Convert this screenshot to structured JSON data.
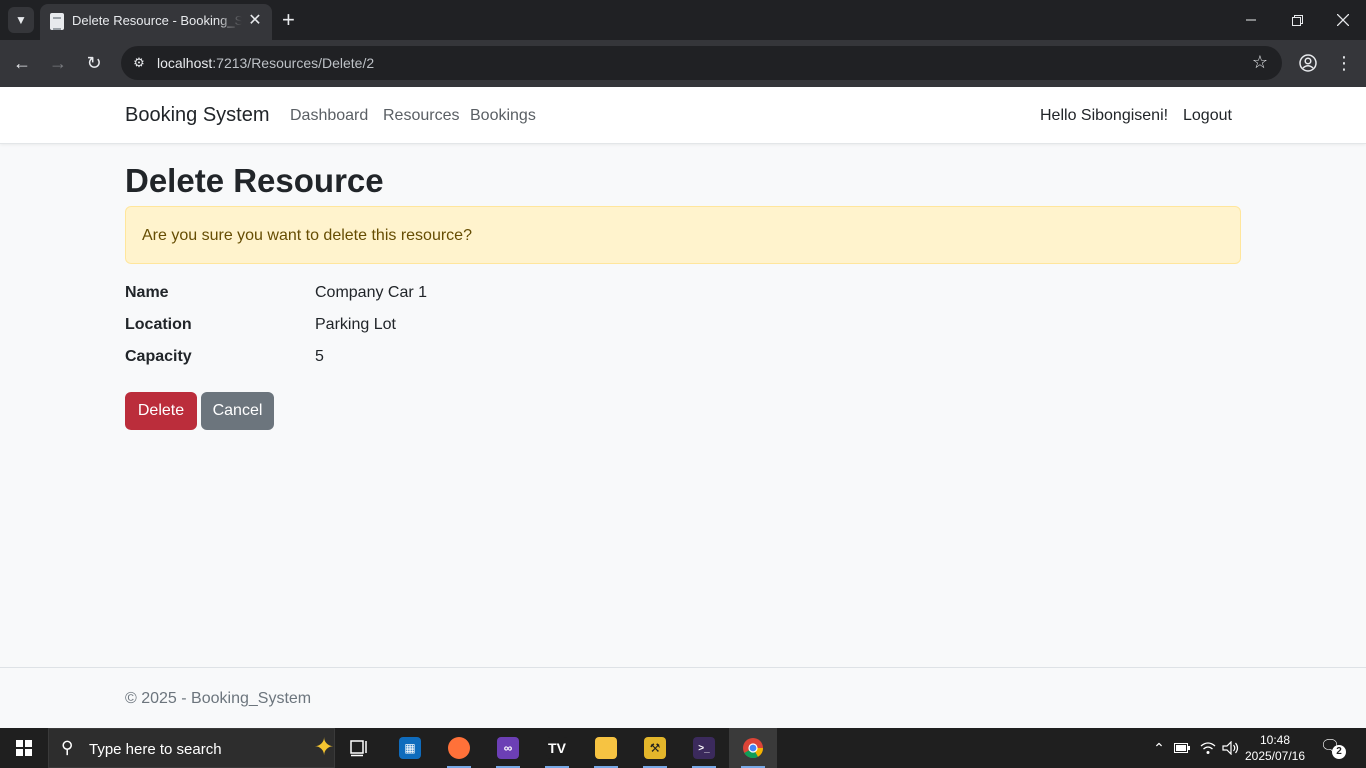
{
  "browser": {
    "tab_title": "Delete Resource - Booking_System",
    "tab_close": "✕",
    "new_tab": "+",
    "url_host": "localhost",
    "url_path": ":7213/Resources/Delete/2"
  },
  "navbar": {
    "brand": "Booking System",
    "links": [
      "Dashboard",
      "Resources",
      "Bookings"
    ],
    "greeting": "Hello Sibongiseni!",
    "logout": "Logout"
  },
  "main": {
    "title": "Delete Resource",
    "alert": "Are you sure you want to delete this resource?",
    "details": [
      {
        "label": "Name",
        "value": "Company Car 1"
      },
      {
        "label": "Location",
        "value": "Parking Lot"
      },
      {
        "label": "Capacity",
        "value": "5"
      }
    ],
    "delete_label": "Delete",
    "cancel_label": "Cancel"
  },
  "footer": {
    "text": "© 2025 - Booking_System"
  },
  "taskbar": {
    "search_placeholder": "Type here to search",
    "time": "10:48",
    "date": "2025/07/16",
    "notifications": "2"
  },
  "colors": {
    "danger": "#bb2d3b",
    "secondary": "#6c757d",
    "warning_bg": "#fff3cd"
  }
}
